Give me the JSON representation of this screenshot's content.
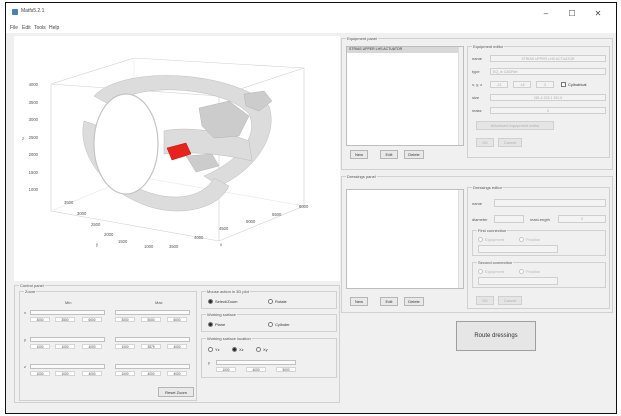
{
  "window": {
    "title": "Matfs5.2.1",
    "minimize_glyph": "–",
    "maximize_glyph": "☐",
    "close_glyph": "✕"
  },
  "menu": [
    "File",
    "Edit",
    "Tools",
    "Help"
  ],
  "plot": {
    "z_axis_label": "z",
    "x_axis_label": "x",
    "y_axis_label": "y",
    "z_ticks": [
      "4000",
      "3500",
      "3000",
      "2500",
      "2000",
      "1500",
      "1000"
    ],
    "y_ticks": [
      "3500",
      "3000",
      "2500",
      "2000",
      "1500",
      "1000"
    ],
    "x_ticks": [
      "3500",
      "4000",
      "4500",
      "5000",
      "5500",
      "6000"
    ]
  },
  "control_panel": {
    "title": "Control panel",
    "zoom_title": "Zoom",
    "min_header": "Min",
    "max_header": "Max",
    "rows": [
      {
        "axis": "x",
        "min": [
          "3000",
          "3500",
          "6000"
        ],
        "max": [
          "3000",
          "5000",
          "6000"
        ]
      },
      {
        "axis": "y",
        "min": [
          "1000",
          "1000",
          "4000"
        ],
        "max": [
          "1000",
          "3879",
          "4000"
        ]
      },
      {
        "axis": "z",
        "min": [
          "1000",
          "1000",
          "4000"
        ],
        "max": [
          "1000",
          "4000",
          "4000"
        ]
      }
    ],
    "reset_zoom": "Reset Zoom",
    "mouse_title": "Mouse action in 3D plot",
    "mouse_options": [
      "Select/Zoom",
      "Rotate"
    ],
    "surface_title": "Working surface",
    "surface_options": [
      "Plane",
      "Cylinder"
    ],
    "location_title": "Working surface location",
    "location_options": [
      "Yz",
      "Xz",
      "Xy"
    ],
    "location_axis": "y",
    "location_values": [
      "1000",
      "4000",
      "5000"
    ]
  },
  "equipment_panel": {
    "title": "Equipment panel",
    "items": [
      "STRIAS UPPER LHS ACTUATOR"
    ],
    "buttons": [
      "New",
      "Edit",
      "Delete"
    ],
    "editor": {
      "title": "Equipment editor",
      "name_label": "name",
      "name_value": "STRIAS UPPER LHS ACTUATOR",
      "type_label": "type",
      "type_value": "EQ_in CADPart",
      "xyz_label": "x, y, z",
      "xyz_values": [
        "-21",
        "-16",
        "3"
      ],
      "cylindrical_label": "Cylindrical",
      "size_label": "size",
      "size_value": "281.4 233.1 292.5",
      "mass_label": "mass",
      "mass_value": "0",
      "advanced_button": "Advanced equipment editor",
      "ok_button": "OK",
      "cancel_button": "Cancel"
    }
  },
  "dressings_panel": {
    "title": "Dressings panel",
    "buttons": [
      "New",
      "Edit",
      "Delete"
    ],
    "editor": {
      "title": "Dressings editor",
      "name_label": "name",
      "diameter_label": "diameter",
      "maxlength_label": "maxLength",
      "maxlength_value": "0",
      "first_connection": "First connection",
      "second_connection": "Second connection",
      "equipment_label": "Equipment",
      "position_label": "Position",
      "ok_button": "OK",
      "cancel_button": "Cancel"
    }
  },
  "route_button": "Route dressings",
  "colors": {
    "actuator": "#e8231e",
    "surface": "#dcdcdc"
  }
}
